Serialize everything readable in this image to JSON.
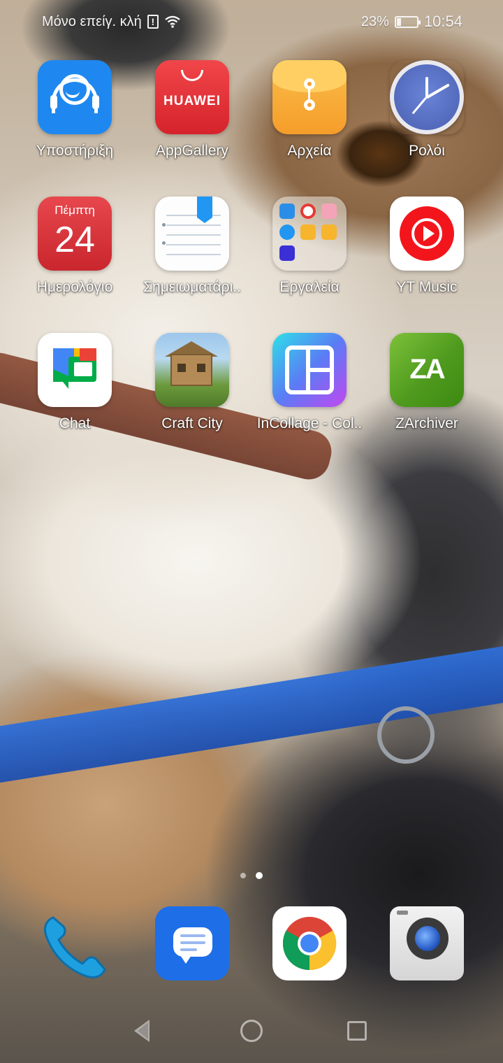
{
  "status_bar": {
    "carrier": "Μόνο επείγ. κλή",
    "battery": "23%",
    "battery_level": 0.23,
    "time": "10:54"
  },
  "apps": [
    {
      "label": "Υποστήριξη",
      "icon": "support-headset-icon"
    },
    {
      "label": "AppGallery",
      "icon": "appgallery-icon",
      "text": "HUAWEI"
    },
    {
      "label": "Αρχεία",
      "icon": "files-envelope-icon"
    },
    {
      "label": "Ρολόι",
      "icon": "clock-icon"
    },
    {
      "label": "Ημερολόγιο",
      "icon": "calendar-icon",
      "day": "Πέμπτη",
      "date": "24"
    },
    {
      "label": "Σημειωματάρι..",
      "icon": "notepad-icon"
    },
    {
      "label": "Εργαλεία",
      "icon": "tools-folder-icon"
    },
    {
      "label": "YT Music",
      "icon": "yt-music-icon"
    },
    {
      "label": "Chat",
      "icon": "google-chat-icon"
    },
    {
      "label": "Craft City",
      "icon": "craft-city-icon"
    },
    {
      "label": "InCollage - Col..",
      "icon": "incollage-icon"
    },
    {
      "label": "ZArchiver",
      "icon": "zarchiver-icon",
      "text": "ZA"
    }
  ],
  "dock": [
    {
      "name": "Phone",
      "icon": "phone-icon"
    },
    {
      "name": "Messages",
      "icon": "messages-icon"
    },
    {
      "name": "Chrome",
      "icon": "chrome-icon"
    },
    {
      "name": "Camera",
      "icon": "camera-icon"
    }
  ],
  "pages": {
    "count": 2,
    "active": 2
  },
  "colors": {
    "support": "#1e88f0",
    "appgallery": "#e0303a",
    "files": "#f7a935",
    "calendar": "#d8333a",
    "ytmusic": "#f2161c",
    "zarchiver": "#5aa626",
    "messages": "#1e6ee8"
  }
}
